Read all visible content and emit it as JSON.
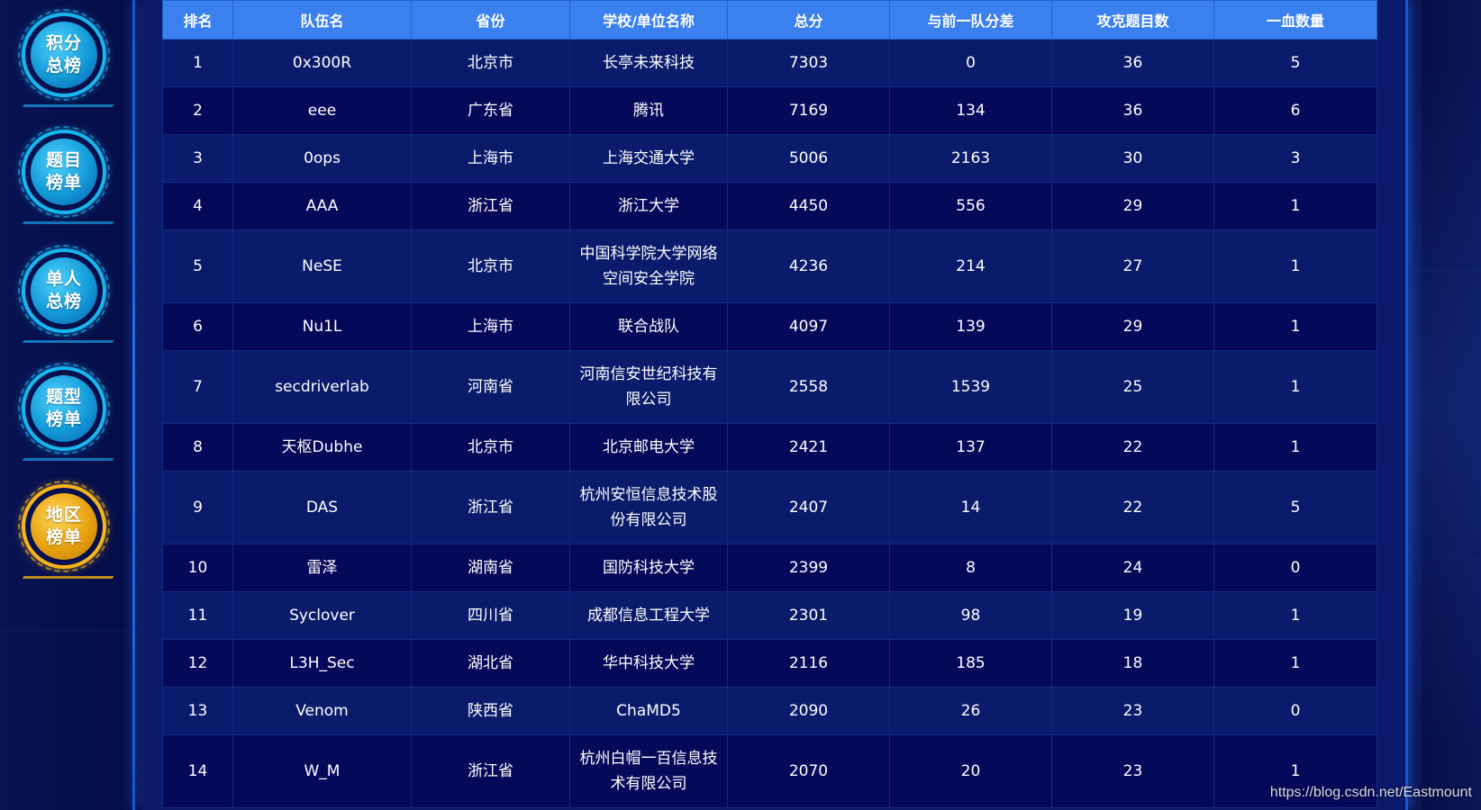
{
  "sidebar": {
    "items": [
      {
        "line1": "积分",
        "line2": "总榜",
        "active": false
      },
      {
        "line1": "题目",
        "line2": "榜单",
        "active": false
      },
      {
        "line1": "单人",
        "line2": "总榜",
        "active": false
      },
      {
        "line1": "题型",
        "line2": "榜单",
        "active": false
      },
      {
        "line1": "地区",
        "line2": "榜单",
        "active": true
      }
    ]
  },
  "table": {
    "headers": [
      "排名",
      "队伍名",
      "省份",
      "学校/单位名称",
      "总分",
      "与前一队分差",
      "攻克题目数",
      "一血数量"
    ],
    "rows": [
      {
        "rank": "1",
        "team": "0x300R",
        "province": "北京市",
        "org": "长亭未来科技",
        "score": "7303",
        "gap": "0",
        "solved": "36",
        "bloods": "5"
      },
      {
        "rank": "2",
        "team": "eee",
        "province": "广东省",
        "org": "腾讯",
        "score": "7169",
        "gap": "134",
        "solved": "36",
        "bloods": "6"
      },
      {
        "rank": "3",
        "team": "0ops",
        "province": "上海市",
        "org": "上海交通大学",
        "score": "5006",
        "gap": "2163",
        "solved": "30",
        "bloods": "3"
      },
      {
        "rank": "4",
        "team": "AAA",
        "province": "浙江省",
        "org": "浙江大学",
        "score": "4450",
        "gap": "556",
        "solved": "29",
        "bloods": "1"
      },
      {
        "rank": "5",
        "team": "NeSE",
        "province": "北京市",
        "org": "中国科学院大学网络空间安全学院",
        "score": "4236",
        "gap": "214",
        "solved": "27",
        "bloods": "1"
      },
      {
        "rank": "6",
        "team": "Nu1L",
        "province": "上海市",
        "org": "联合战队",
        "score": "4097",
        "gap": "139",
        "solved": "29",
        "bloods": "1"
      },
      {
        "rank": "7",
        "team": "secdriverlab",
        "province": "河南省",
        "org": "河南信安世纪科技有限公司",
        "score": "2558",
        "gap": "1539",
        "solved": "25",
        "bloods": "1"
      },
      {
        "rank": "8",
        "team": "天枢Dubhe",
        "province": "北京市",
        "org": "北京邮电大学",
        "score": "2421",
        "gap": "137",
        "solved": "22",
        "bloods": "1"
      },
      {
        "rank": "9",
        "team": "DAS",
        "province": "浙江省",
        "org": "杭州安恒信息技术股份有限公司",
        "score": "2407",
        "gap": "14",
        "solved": "22",
        "bloods": "5"
      },
      {
        "rank": "10",
        "team": "雷泽",
        "province": "湖南省",
        "org": "国防科技大学",
        "score": "2399",
        "gap": "8",
        "solved": "24",
        "bloods": "0"
      },
      {
        "rank": "11",
        "team": "Syclover",
        "province": "四川省",
        "org": "成都信息工程大学",
        "score": "2301",
        "gap": "98",
        "solved": "19",
        "bloods": "1"
      },
      {
        "rank": "12",
        "team": "L3H_Sec",
        "province": "湖北省",
        "org": "华中科技大学",
        "score": "2116",
        "gap": "185",
        "solved": "18",
        "bloods": "1"
      },
      {
        "rank": "13",
        "team": "Venom",
        "province": "陕西省",
        "org": "ChaMD5",
        "score": "2090",
        "gap": "26",
        "solved": "23",
        "bloods": "0"
      },
      {
        "rank": "14",
        "team": "W_M",
        "province": "浙江省",
        "org": "杭州白帽一百信息技术有限公司",
        "score": "2070",
        "gap": "20",
        "solved": "23",
        "bloods": "1"
      }
    ]
  },
  "watermark": "https://blog.csdn.net/Eastmount",
  "colors": {
    "header_bg": "#3a80ee",
    "row_odd": "#0a1b6b",
    "row_even": "#06085a",
    "nav_blue": "#18b6ee",
    "nav_active": "#f6b61a"
  },
  "icons": {
    "nav_badge": "circular-badge-icon"
  }
}
